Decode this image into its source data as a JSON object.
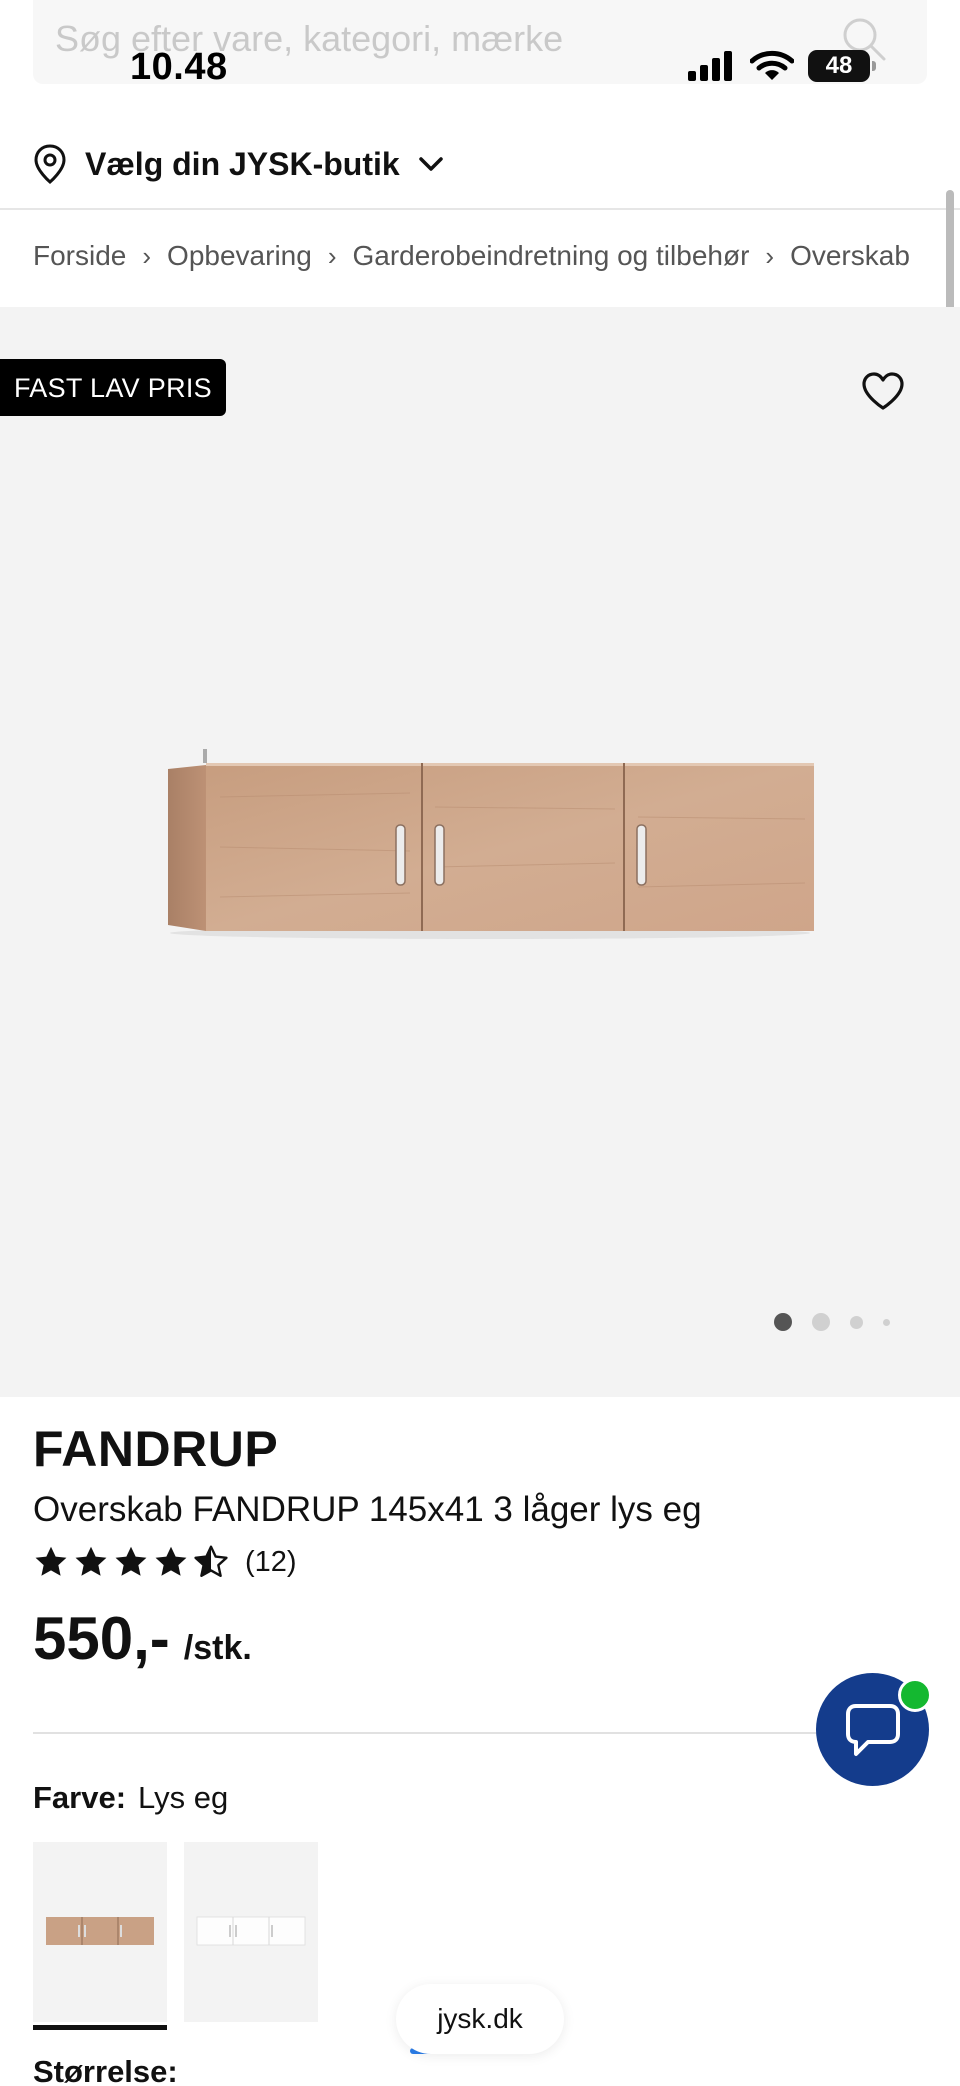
{
  "status": {
    "time": "10.48",
    "battery": "48"
  },
  "search": {
    "placeholder": "Søg efter vare, kategori, mærke"
  },
  "store": {
    "label": "Vælg din JYSK-butik"
  },
  "breadcrumb": [
    "Forside",
    "Opbevaring",
    "Garderobeindretning og tilbehør",
    "Overskab"
  ],
  "hero": {
    "badge": "FAST LAV PRIS",
    "image_count": 4,
    "active_image": 1
  },
  "product": {
    "brand": "FANDRUP",
    "title": "Overskab FANDRUP 145x41 3 låger lys eg",
    "rating": 4.5,
    "rating_count": "(12)",
    "price": "550,-",
    "unit": "/stk."
  },
  "color": {
    "label": "Farve:",
    "value": "Lys eg",
    "options": [
      "Lys eg",
      "Hvid"
    ],
    "selected": 0
  },
  "size": {
    "label": "Størrelse:"
  },
  "browser": {
    "url": "jysk.dk"
  },
  "colors": {
    "chat": "#143c8c",
    "online": "#14b830",
    "hero_bg": "#f3f3f3"
  }
}
